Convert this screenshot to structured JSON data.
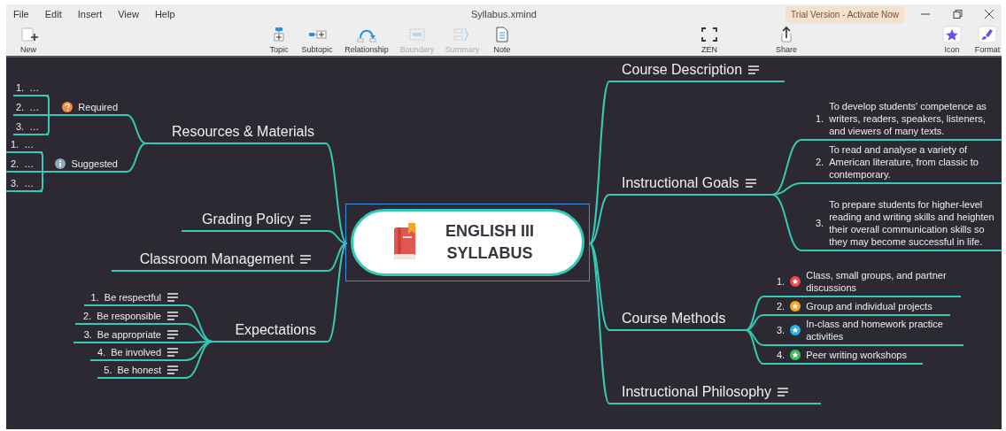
{
  "window": {
    "title": "Syllabus.xmind"
  },
  "menu": [
    "File",
    "Edit",
    "Insert",
    "View",
    "Help"
  ],
  "trial_badge": "Trial Version - Activate Now",
  "toolbar": [
    {
      "kind": "new",
      "label": "New",
      "disabled": false
    },
    {
      "kind": "topic",
      "label": "Topic",
      "disabled": false
    },
    {
      "kind": "subtopic",
      "label": "Subtopic",
      "disabled": false
    },
    {
      "kind": "relationship",
      "label": "Relationship",
      "disabled": false
    },
    {
      "kind": "boundary",
      "label": "Boundary",
      "disabled": true
    },
    {
      "kind": "summary",
      "label": "Summary",
      "disabled": true
    },
    {
      "kind": "note",
      "label": "Note",
      "disabled": false
    },
    {
      "kind": "zen",
      "label": "ZEN",
      "disabled": false
    },
    {
      "kind": "share",
      "label": "Share",
      "disabled": false
    },
    {
      "kind": "icon",
      "label": "Icon",
      "disabled": false
    },
    {
      "kind": "format",
      "label": "Format",
      "disabled": false
    }
  ],
  "central_topic": {
    "title": "ENGLISH III SYLLABUS"
  },
  "left_topics": [
    {
      "title": "Resources & Materials",
      "has_note": false,
      "children": [
        {
          "title": "Required",
          "kind": "question",
          "children": [
            {
              "number": "1.",
              "title": "…"
            },
            {
              "number": "2.",
              "title": "…"
            },
            {
              "number": "3.",
              "title": "…"
            }
          ]
        },
        {
          "title": "Suggested",
          "kind": "info",
          "children": [
            {
              "number": "1.",
              "title": "…"
            },
            {
              "number": "2.",
              "title": "…"
            },
            {
              "number": "3.",
              "title": "…"
            }
          ]
        }
      ]
    },
    {
      "title": "Grading Policy",
      "has_note": true
    },
    {
      "title": "Classroom Management",
      "has_note": true
    },
    {
      "title": "Expectations",
      "has_note": false,
      "children": [
        {
          "number": "1.",
          "title": "Be respectful",
          "has_note": true
        },
        {
          "number": "2.",
          "title": "Be responsible",
          "has_note": true
        },
        {
          "number": "3.",
          "title": "Be appropriate",
          "has_note": true
        },
        {
          "number": "4.",
          "title": "Be involved",
          "has_note": true
        },
        {
          "number": "5.",
          "title": "Be honest",
          "has_note": true
        }
      ]
    }
  ],
  "right_topics": [
    {
      "title": "Course Description",
      "has_note": true
    },
    {
      "title": "Instructional Goals",
      "has_note": true,
      "children": [
        {
          "number": "1.",
          "title": "To develop students' competence as writers, readers, speakers, listeners, and viewers of many texts."
        },
        {
          "number": "2.",
          "title": "To read and analyse a variety of American literature, from classic to contemporary."
        },
        {
          "number": "3.",
          "title": "To prepare students for higher-level reading and writing skills and heighten their overall communication skills so they may become successful in life."
        }
      ]
    },
    {
      "title": "Course Methods",
      "has_note": false,
      "children": [
        {
          "number": "1.",
          "title": "Class, small groups, and partner discussions",
          "color": "#e84c4c"
        },
        {
          "number": "2.",
          "title": "Group and individual projects",
          "color": "#f5a623"
        },
        {
          "number": "3.",
          "title": "In-class and homework practice activities",
          "color": "#27b5e8"
        },
        {
          "number": "4.",
          "title": "Peer writing workshops",
          "color": "#3cc15a"
        }
      ]
    },
    {
      "title": "Instructional Philosophy",
      "has_note": true
    }
  ]
}
